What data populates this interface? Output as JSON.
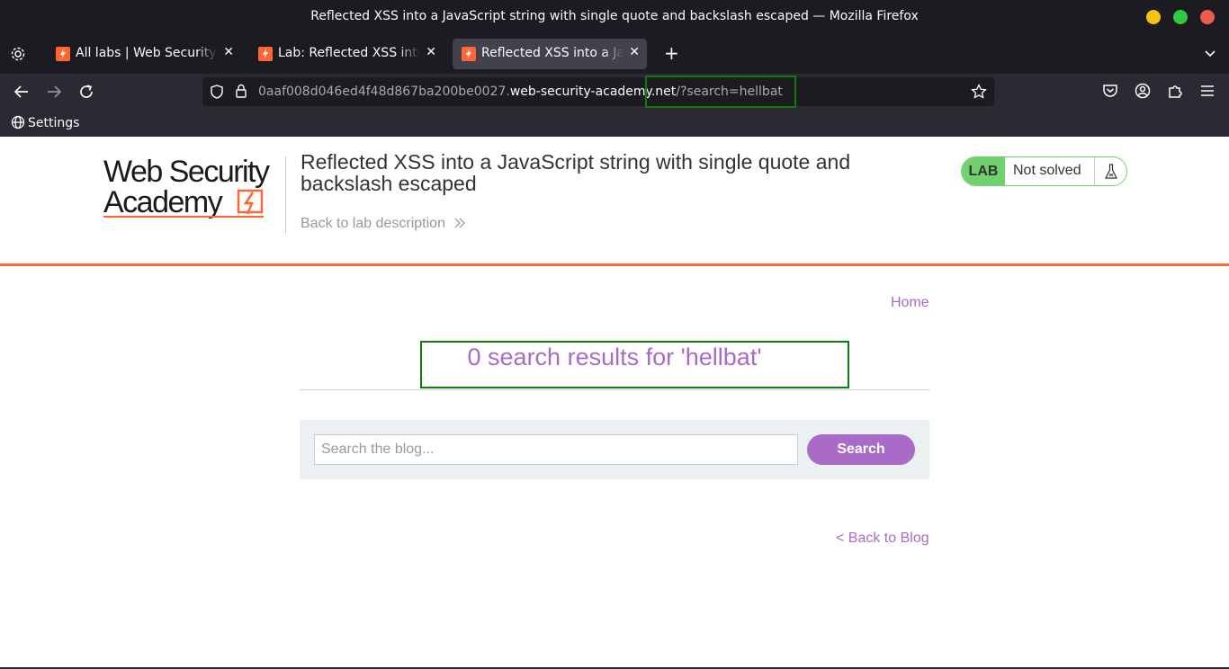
{
  "window": {
    "title": "Reflected XSS into a JavaScript string with single quote and backslash escaped — Mozilla Firefox"
  },
  "tabs": [
    {
      "label": "All labs | Web Security Academy",
      "active": false
    },
    {
      "label": "Lab: Reflected XSS into a JavaScript string",
      "active": false
    },
    {
      "label": "Reflected XSS into a JavaScript string",
      "active": true
    }
  ],
  "navbar": {
    "url_subdomain": "0aaf008d046ed4f48d867ba200be0027.",
    "url_domain": "web-security-academy.net",
    "url_path": "/?search=hellbat"
  },
  "bookmarks": {
    "settings_label": "Settings"
  },
  "header": {
    "logo_line1": "Web Security",
    "logo_line2": "Academy",
    "lab_title": "Reflected XSS into a JavaScript string with single quote and backslash escaped",
    "back_to_description": "Back to lab description",
    "badge_label": "LAB",
    "badge_status": "Not solved"
  },
  "main": {
    "home_link": "Home",
    "results_heading": "0 search results for 'hellbat'",
    "search_placeholder": "Search the blog...",
    "search_button": "Search",
    "back_to_blog": "< Back to Blog"
  },
  "colors": {
    "accent_purple": "#a96bc7",
    "brand_orange": "#ff6633",
    "lab_green": "#70d16d",
    "highlight_green": "#0f7a0f"
  }
}
